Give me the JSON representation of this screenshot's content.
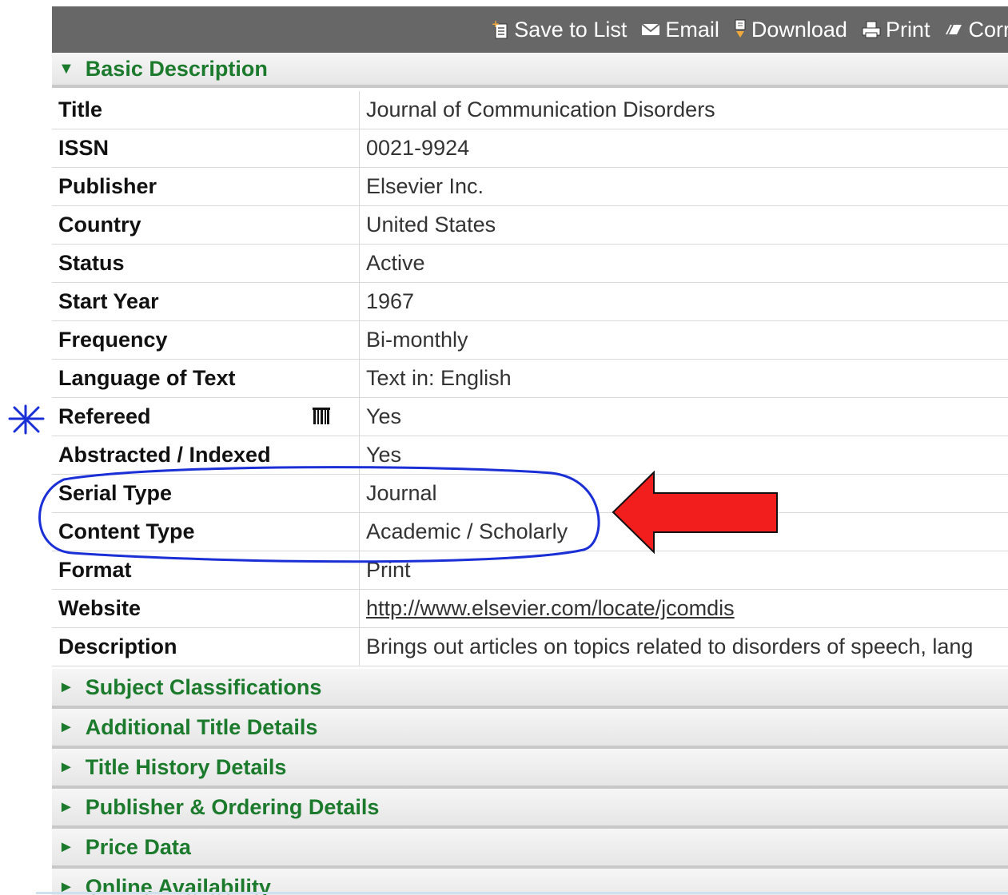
{
  "toolbar": {
    "items": [
      {
        "label": "Save to List",
        "icon": "save-to-list-icon"
      },
      {
        "label": "Email",
        "icon": "email-icon"
      },
      {
        "label": "Download",
        "icon": "download-icon"
      },
      {
        "label": "Print",
        "icon": "print-icon"
      },
      {
        "label": "Correctio",
        "icon": "correction-icon"
      }
    ]
  },
  "basic": {
    "header": "Basic Description",
    "rows": [
      {
        "label": "Title",
        "value": "Journal of Communication Disorders"
      },
      {
        "label": "ISSN",
        "value": "0021-9924"
      },
      {
        "label": "Publisher",
        "value": "Elsevier Inc."
      },
      {
        "label": "Country",
        "value": "United States"
      },
      {
        "label": "Status",
        "value": "Active"
      },
      {
        "label": "Start Year",
        "value": "1967"
      },
      {
        "label": "Frequency",
        "value": "Bi-monthly"
      },
      {
        "label": "Language of Text",
        "value": "Text in: English"
      },
      {
        "label": "Refereed",
        "value": "Yes"
      },
      {
        "label": "Abstracted / Indexed",
        "value": "Yes"
      },
      {
        "label": "Serial Type",
        "value": "Journal"
      },
      {
        "label": "Content Type",
        "value": "Academic / Scholarly"
      },
      {
        "label": "Format",
        "value": "Print"
      },
      {
        "label": "Website",
        "value": "http://www.elsevier.com/locate/jcomdis"
      },
      {
        "label": "Description",
        "value": "Brings out articles on topics related to disorders of speech, lang"
      }
    ]
  },
  "sections": [
    "Subject Classifications",
    "Additional Title Details",
    "Title History Details",
    "Publisher & Ordering Details",
    "Price Data",
    "Online Availability"
  ],
  "colors": {
    "toolbar_bg": "#676767",
    "section_text": "#1b7a2c",
    "annotation_circle": "#1a2fd6",
    "annotation_arrow": "#f21d1d"
  }
}
